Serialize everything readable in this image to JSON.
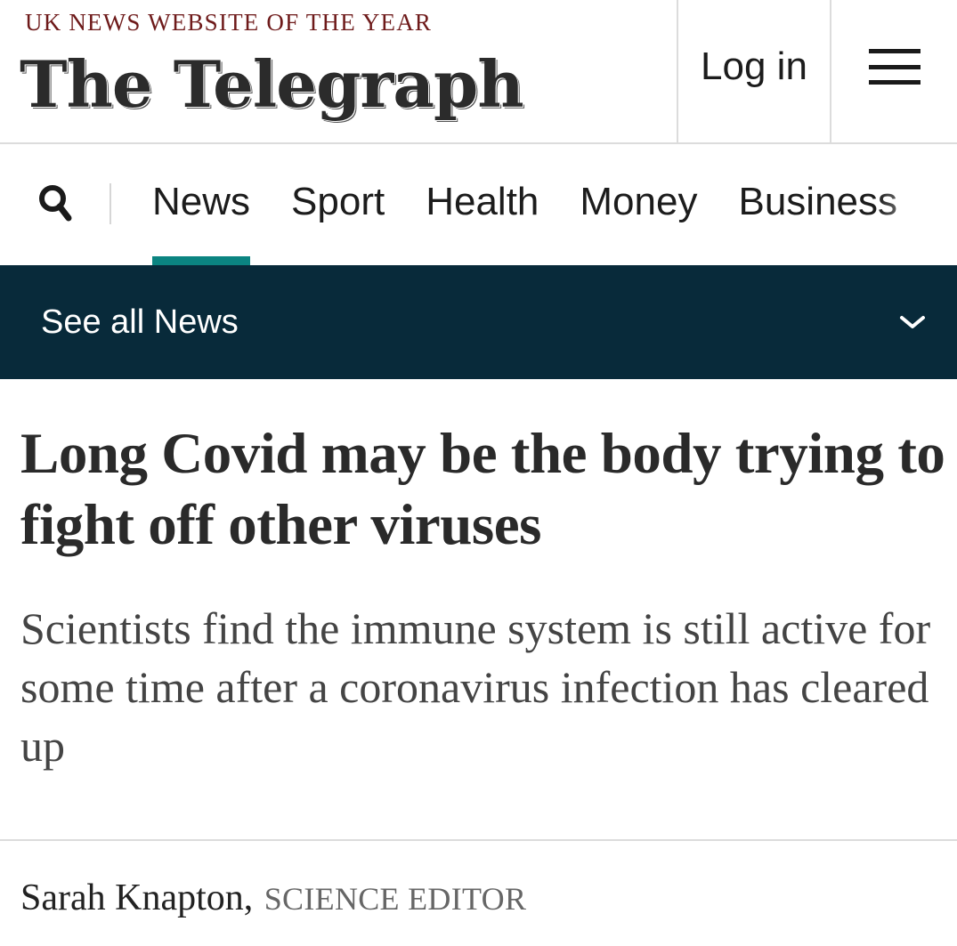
{
  "header": {
    "tagline": "UK NEWS WEBSITE OF THE YEAR",
    "masthead": "The Telegraph",
    "login_label": "Log in",
    "menu_icon": "hamburger-menu-icon"
  },
  "nav": {
    "search_icon": "search-icon",
    "items": [
      {
        "label": "News",
        "active": true
      },
      {
        "label": "Sport",
        "active": false
      },
      {
        "label": "Health",
        "active": false
      },
      {
        "label": "Money",
        "active": false
      },
      {
        "label": "Business",
        "active": false
      }
    ],
    "active_color": "#0b8481"
  },
  "section_bar": {
    "label": "See all News",
    "background": "#082a3a",
    "icon": "chevron-down-icon"
  },
  "article": {
    "headline": "Long Covid may be the body trying to fight off other viruses",
    "standfirst": "Scientists find the immune system is still active for some time after a coronavirus infection has cleared up",
    "author": "Sarah Knapton,",
    "author_role": "SCIENCE EDITOR"
  }
}
